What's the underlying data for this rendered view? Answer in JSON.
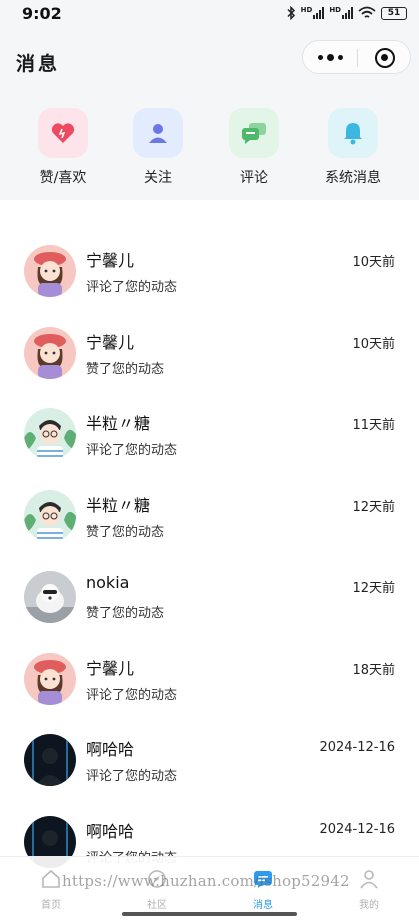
{
  "status_bar": {
    "time": "9:02",
    "battery": "51",
    "signal_label": "HD"
  },
  "header": {
    "title": "消息"
  },
  "categories": [
    {
      "label": "赞/喜欢",
      "icon": "heart-icon",
      "bg": "#fde3ea",
      "color": "#ee4b63"
    },
    {
      "label": "关注",
      "icon": "person-icon",
      "bg": "#e3ecff",
      "color": "#6a78e8"
    },
    {
      "label": "评论",
      "icon": "chat-icon",
      "bg": "#e2f5e6",
      "color": "#4fb86a"
    },
    {
      "label": "系统消息",
      "icon": "bell-icon",
      "bg": "#dff4f8",
      "color": "#3cb8e0"
    }
  ],
  "messages": [
    {
      "name": "宁馨儿",
      "action": "评论了您的动态",
      "time": "10天前",
      "avatar": "girl-avatar"
    },
    {
      "name": "宁馨儿",
      "action": "赞了您的动态",
      "time": "10天前",
      "avatar": "girl-avatar"
    },
    {
      "name": "半粒〃糖",
      "action": "评论了您的动态",
      "time": "11天前",
      "avatar": "boy-avatar"
    },
    {
      "name": "半粒〃糖",
      "action": "赞了您的动态",
      "time": "12天前",
      "avatar": "boy-avatar"
    },
    {
      "name": "nokia",
      "action": "赞了您的动态",
      "time": "12天前",
      "avatar": "dog-avatar"
    },
    {
      "name": "宁馨儿",
      "action": "评论了您的动态",
      "time": "18天前",
      "avatar": "girl-avatar"
    },
    {
      "name": "啊哈哈",
      "action": "评论了您的动态",
      "time": "2024-12-16",
      "avatar": "dark-avatar"
    },
    {
      "name": "啊哈哈",
      "action": "评论了您的动态",
      "time": "2024-12-16",
      "avatar": "dark-avatar"
    }
  ],
  "tabbar": {
    "tabs": [
      {
        "label": "首页",
        "icon": "home-icon",
        "active": false
      },
      {
        "label": "社区",
        "icon": "community-icon",
        "active": false
      },
      {
        "label": "消息",
        "icon": "message-icon",
        "active": true
      },
      {
        "label": "我的",
        "icon": "profile-icon",
        "active": false
      }
    ],
    "active_color": "#2d9cf0"
  },
  "watermark": "https://www.huzhan.com/ishop52942"
}
